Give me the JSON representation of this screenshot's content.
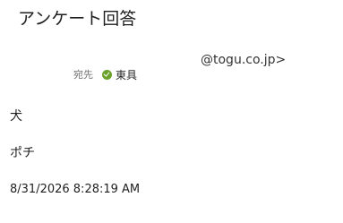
{
  "message": {
    "subject": "アンケート回答",
    "sender_address": "@togu.co.jp>",
    "recipient": {
      "label": "宛先",
      "name": "東具",
      "status_icon": "check-circle-icon",
      "status_color": "#6aa22b"
    },
    "body": {
      "lines": [
        "犬",
        "ポチ"
      ],
      "timestamp": "8/31/2026 8:28:19 AM"
    }
  }
}
